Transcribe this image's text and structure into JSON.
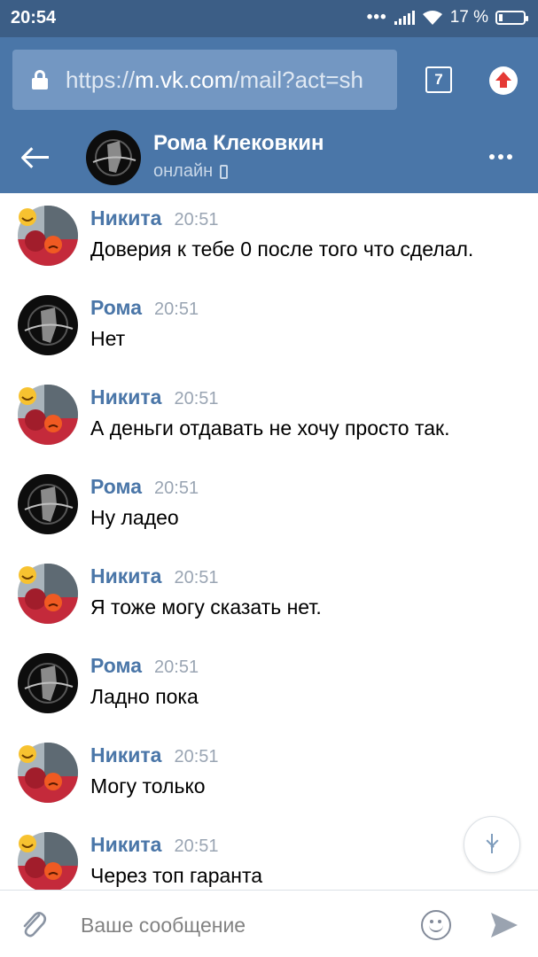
{
  "status_bar": {
    "time": "20:54",
    "battery": "17 %"
  },
  "browser": {
    "url_scheme": "https://",
    "url_host": "m.vk.com",
    "url_path": "/mail?act=sh",
    "tab_count": "7"
  },
  "chat": {
    "peer_name": "Рома Клековкин",
    "status": "онлайн"
  },
  "messages": [
    {
      "author": "Никита",
      "time": "20:51",
      "text": "Доверия к тебе 0 после того что сделал."
    },
    {
      "author": "Рома",
      "time": "20:51",
      "text": "Нет"
    },
    {
      "author": "Никита",
      "time": "20:51",
      "text": "А деньги отдавать не хочу просто так."
    },
    {
      "author": "Рома",
      "time": "20:51",
      "text": "Ну ладео"
    },
    {
      "author": "Никита",
      "time": "20:51",
      "text": "Я тоже могу сказать нет."
    },
    {
      "author": "Рома",
      "time": "20:51",
      "text": "Ладно пока"
    },
    {
      "author": "Никита",
      "time": "20:51",
      "text": "Могу только"
    },
    {
      "author": "Никита",
      "time": "20:51",
      "text": "Через топ гаранта"
    }
  ],
  "composer": {
    "placeholder": "Ваше сообщение"
  },
  "colors": {
    "header": "#4a76a8",
    "status_bar": "#3c5e86",
    "author": "#4a76a8",
    "time": "#9aa5b3"
  }
}
